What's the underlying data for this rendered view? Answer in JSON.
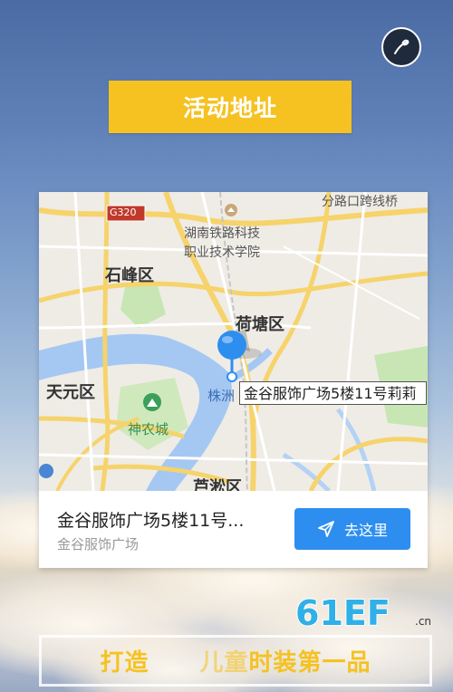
{
  "header": {
    "title": "活动地址"
  },
  "music_button": {
    "icon": "music-note-icon"
  },
  "map": {
    "labels": {
      "highway": "G320",
      "university_line1": "湖南铁路科技",
      "university_line2": "职业技术学院",
      "district_shifeng": "石峰区",
      "district_hetang": "荷塘区",
      "district_tianyuan": "天元区",
      "shennong_city": "神农城",
      "lusong": "芦淞区",
      "zhuzhou_partial": "株洲",
      "overpass": "分路口跨线桥"
    },
    "pin_address": "金谷服饰广场5楼11号莉莉",
    "colors": {
      "water": "#a5c8f2",
      "road_major": "#f6d36b",
      "road_minor": "#ffffff",
      "park": "#bfe3a8",
      "pin": "#2d8ef0"
    }
  },
  "place": {
    "name": "金谷服饰广场5楼11号...",
    "subtitle": "金谷服饰广场",
    "go_label": "去这里"
  },
  "logo": {
    "text": "61EF",
    "suffix": ".cn"
  },
  "slogan": {
    "part1": "打造",
    "part2": "儿童",
    "part3": "时装第一品"
  }
}
